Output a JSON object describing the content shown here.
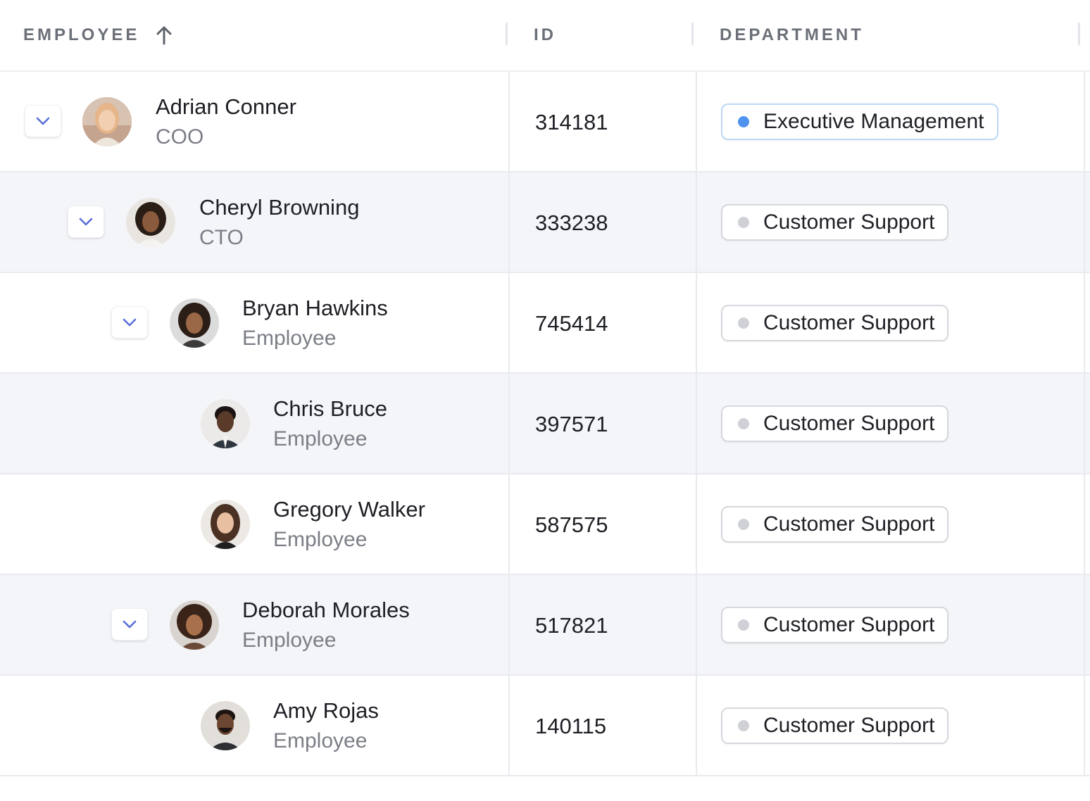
{
  "table": {
    "columns": {
      "employee": "EMPLOYEE",
      "id": "ID",
      "department": "DEPARTMENT"
    },
    "sort": {
      "column": "employee",
      "direction": "ascending",
      "icon": "arrow-up-icon"
    },
    "rows": [
      {
        "name": "Adrian Conner",
        "role": "COO",
        "id": "314181",
        "department": "Executive Management",
        "expandable": true,
        "level": 0,
        "dept_color": "#4f93ef"
      },
      {
        "name": "Cheryl Browning",
        "role": "CTO",
        "id": "333238",
        "department": "Customer Support",
        "expandable": true,
        "level": 1,
        "dept_color": "#cfd1d6"
      },
      {
        "name": "Bryan Hawkins",
        "role": "Employee",
        "id": "745414",
        "department": "Customer Support",
        "expandable": true,
        "level": 2,
        "dept_color": "#cfd1d6"
      },
      {
        "name": "Chris Bruce",
        "role": "Employee",
        "id": "397571",
        "department": "Customer Support",
        "expandable": false,
        "level": 3,
        "dept_color": "#cfd1d6"
      },
      {
        "name": "Gregory Walker",
        "role": "Employee",
        "id": "587575",
        "department": "Customer Support",
        "expandable": false,
        "level": 3,
        "dept_color": "#cfd1d6"
      },
      {
        "name": "Deborah Morales",
        "role": "Employee",
        "id": "517821",
        "department": "Customer Support",
        "expandable": true,
        "level": 2,
        "dept_color": "#cfd1d6"
      },
      {
        "name": "Amy Rojas",
        "role": "Employee",
        "id": "140115",
        "department": "Customer Support",
        "expandable": false,
        "level": 3,
        "dept_color": "#cfd1d6"
      }
    ]
  },
  "colors": {
    "accent": "#5b6fd6",
    "row_alt": "#f4f5f9",
    "border": "#e8eaee"
  }
}
